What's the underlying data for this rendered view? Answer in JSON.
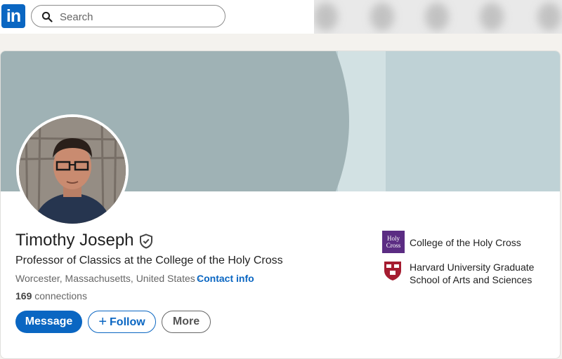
{
  "nav": {
    "logo_text": "in",
    "search_placeholder": "Search"
  },
  "profile": {
    "name": "Timothy Joseph",
    "headline": "Professor of Classics at the College of the Holy Cross",
    "location": "Worcester, Massachusetts, United States",
    "separator": "·",
    "contact_label": "Contact info",
    "connections_count": "169",
    "connections_label": "connections"
  },
  "actions": {
    "message": "Message",
    "follow": "Follow",
    "more": "More"
  },
  "organizations": [
    {
      "name": "College of the Holy Cross",
      "logo_text": "Holy Cross",
      "icon": "holy-cross-logo"
    },
    {
      "name_line1": "Harvard University Graduate",
      "name_line2": "School of Arts and Sciences",
      "icon": "harvard-shield-logo"
    }
  ],
  "colors": {
    "brand": "#0a66c2",
    "holy_cross_purple": "#5b2c83",
    "harvard_crimson": "#a51c30"
  }
}
